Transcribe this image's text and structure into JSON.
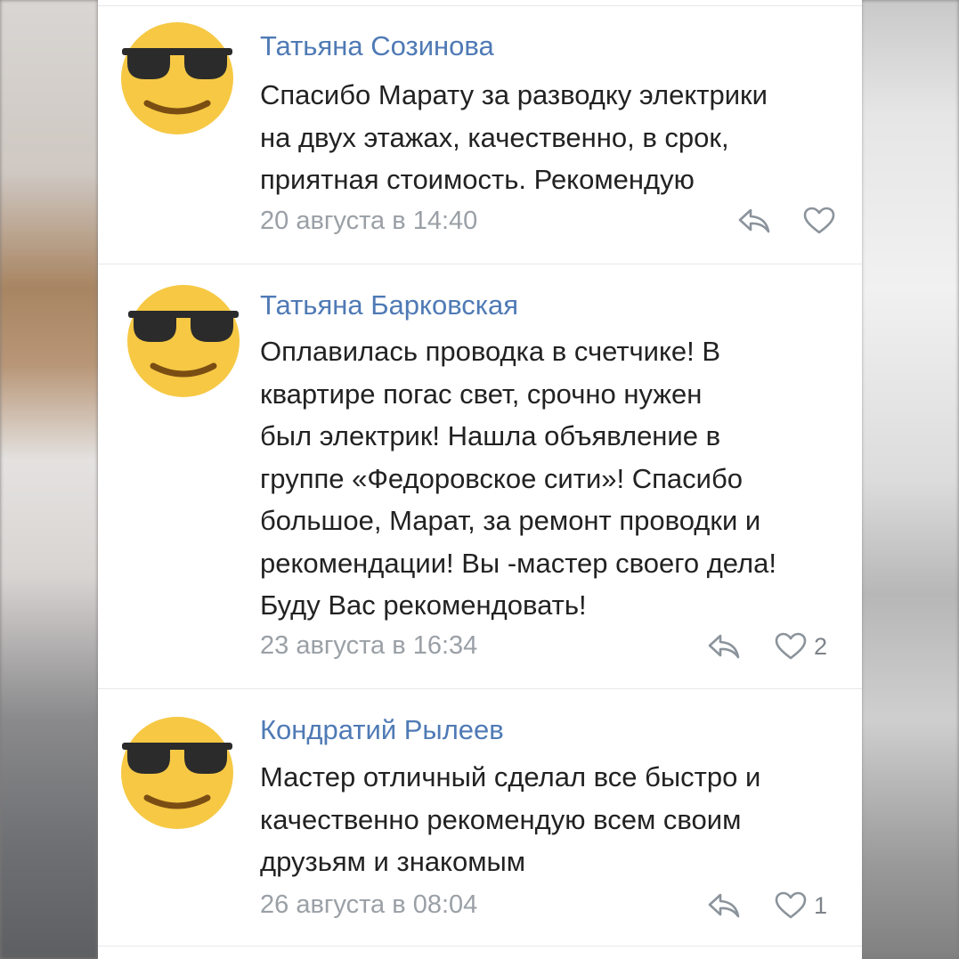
{
  "comments": [
    {
      "author": "Татьяна Созинова",
      "text": "Спасибо Марату за разводку электрики\nна двух этажах,  качественно, в срок,\nприятная стоимость. Рекомендую",
      "time": "20 августа в 14:40",
      "likes": ""
    },
    {
      "author": "Татьяна Барковская",
      "text": "Оплавилась проводка в счетчике! В\nквартире погас свет, срочно нужен\nбыл электрик! Нашла объявление в\nгруппе «Федоровское сити»! Спасибо\nбольшое, Марат, за ремонт проводки и\nрекомендации! Вы -мастер своего дела!\nБуду Вас рекомендовать!",
      "time": "23 августа в 16:34",
      "likes": "2"
    },
    {
      "author": "Кондратий Рылеев",
      "text": "Мастер отличный сделал все быстро и\nкачественно рекомендую всем своим\nдрузьям и знакомым",
      "time": "26 августа в 08:04",
      "likes": "1"
    }
  ],
  "icons": {
    "avatar": "sunglasses-smiley-icon",
    "reply": "reply-arrow-icon",
    "like": "heart-outline-icon"
  },
  "colors": {
    "author": "#4f7ab5",
    "text": "#222222",
    "meta": "#9aa0a6",
    "avatar_face": "#f6c844",
    "glasses": "#2b2b2b"
  }
}
